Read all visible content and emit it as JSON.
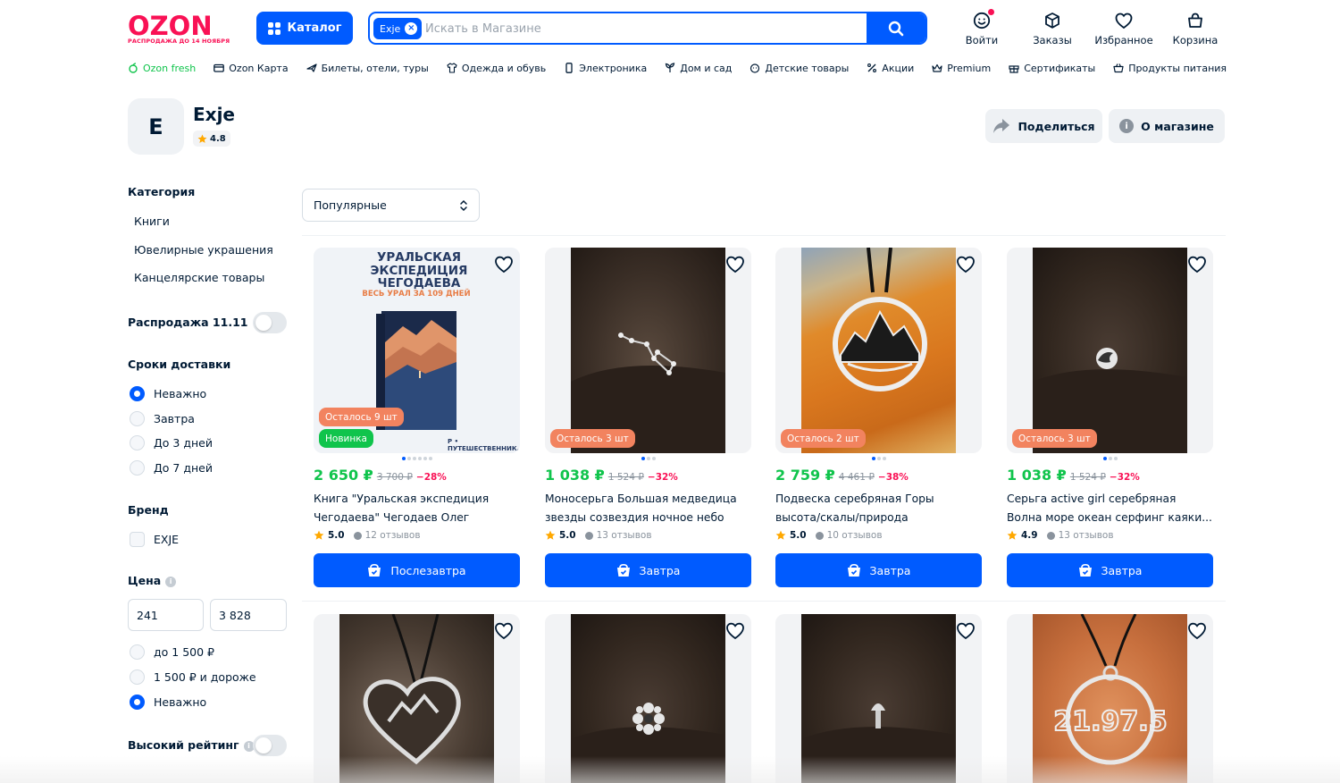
{
  "colors": {
    "brand": "#005bff",
    "logo": "#f91155",
    "price": "#10c44c",
    "discount": "#f91155",
    "stock_badge": "#f2835f",
    "new_badge": "#10c44c"
  },
  "header": {
    "logo": {
      "word": "OZON",
      "subtitle": "РАСПРОДАЖА ДО 14 НОЯБРЯ"
    },
    "catalog_label": "Каталог",
    "search": {
      "chip": "Exje",
      "placeholder": "Искать в Магазине",
      "value": ""
    },
    "actions": [
      {
        "label": "Войти",
        "icon": "face-icon"
      },
      {
        "label": "Заказы",
        "icon": "box-icon"
      },
      {
        "label": "Избранное",
        "icon": "heart-icon"
      },
      {
        "label": "Корзина",
        "icon": "bag-icon"
      }
    ]
  },
  "nav": [
    {
      "label": "Ozon fresh",
      "icon": "fresh-icon"
    },
    {
      "label": "Ozon Карта",
      "icon": "card-icon"
    },
    {
      "label": "Билеты, отели, туры",
      "icon": "plane-icon"
    },
    {
      "label": "Одежда и обувь",
      "icon": "shirt-icon"
    },
    {
      "label": "Электроника",
      "icon": "phone-icon"
    },
    {
      "label": "Дом и сад",
      "icon": "plant-icon"
    },
    {
      "label": "Детские товары",
      "icon": "kid-icon"
    },
    {
      "label": "Акции",
      "icon": "percent-icon"
    },
    {
      "label": "Premium",
      "icon": "crown-icon"
    },
    {
      "label": "Сертификаты",
      "icon": "gift-icon"
    },
    {
      "label": "Продукты питания",
      "icon": "basket-icon"
    }
  ],
  "shop": {
    "avatar_letter": "E",
    "name": "Exje",
    "rating": "4.8",
    "share_label": "Поделиться",
    "about_label": "О магазине"
  },
  "sidebar": {
    "category_title": "Категория",
    "categories": [
      "Книги",
      "Ювелирные украшения",
      "Канцелярские товары"
    ],
    "sale_label": "Распродажа 11.11",
    "delivery_title": "Сроки доставки",
    "delivery_options": [
      "Неважно",
      "Завтра",
      "До 3 дней",
      "До 7 дней"
    ],
    "delivery_selected": "Неважно",
    "brand_title": "Бренд",
    "brand_option": "EXJE",
    "price_title": "Цена",
    "price_min": "241",
    "price_max": "3 828",
    "price_options": [
      "до 1 500 ₽",
      "1 500 ₽ и дороже",
      "Неважно"
    ],
    "price_selected": "Неважно",
    "high_rating_label": "Высокий рейтинг"
  },
  "sort": {
    "selected": "Популярные"
  },
  "products": [
    {
      "price": "2 650 ₽",
      "old_price": "3 700 ₽",
      "discount": "−28%",
      "name": "Книга \"Уральская экспедиция Чегодаева\" Чегодаев Олег",
      "rating": "5.0",
      "reviews": "12 отзывов",
      "button": "Послезавтра",
      "badges": [
        "Осталось 9 шт",
        "Новинка"
      ],
      "book_title": "УРАЛЬСКАЯ ЭКСПЕДИЦИЯ ЧЕГОДАЕВА",
      "book_subtitle": "ВЕСЬ УРАЛ ЗА 109 ДНЕЙ",
      "book_author": "Р • ПУТЕШЕСТВЕННИК, ФОТОГРАФ ОЛЕГ ЧЕГОДАЕВ"
    },
    {
      "price": "1 038 ₽",
      "old_price": "1 524 ₽",
      "discount": "−32%",
      "name": "Моносерьга Большая медведица звезды созвездия ночное небо",
      "rating": "5.0",
      "reviews": "13 отзывов",
      "button": "Завтра",
      "badges": [
        "Осталось 3 шт"
      ]
    },
    {
      "price": "2 759 ₽",
      "old_price": "4 461 ₽",
      "discount": "−38%",
      "name": "Подвеска серебряная Горы высота/скалы/природа",
      "rating": "5.0",
      "reviews": "10 отзывов",
      "button": "Завтра",
      "badges": [
        "Осталось 2 шт"
      ]
    },
    {
      "price": "1 038 ₽",
      "old_price": "1 524 ₽",
      "discount": "−32%",
      "name": "Серьга active girl серебряная Волна море океан серфинг каяки...",
      "rating": "4.9",
      "reviews": "13 отзывов",
      "button": "Завтра",
      "badges": [
        "Осталось 3 шт"
      ]
    }
  ],
  "products_row2": [
    {
      "image_text": ""
    },
    {
      "image_text": ""
    },
    {
      "image_text": ""
    },
    {
      "image_text": "21.97.5"
    }
  ]
}
